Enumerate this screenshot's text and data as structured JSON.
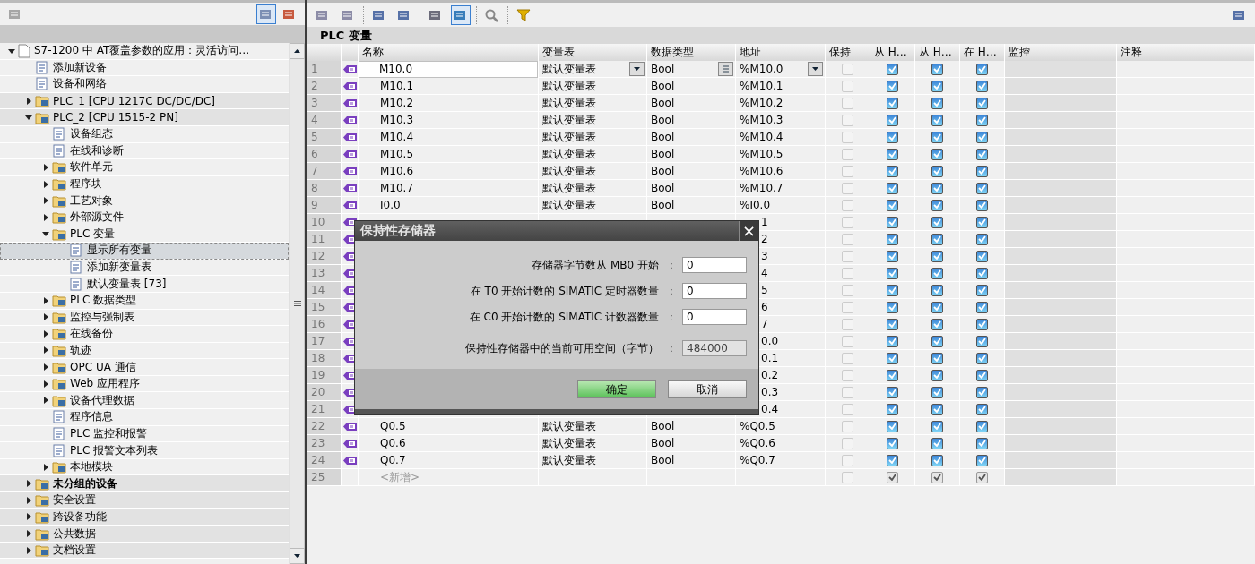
{
  "tree": {
    "items": [
      {
        "label": "S7-1200 中 AT覆盖参数的应用：灵活访问…",
        "kind": "project",
        "expanded": true,
        "selected": false,
        "children": [
          {
            "label": "添加新设备",
            "kind": "item",
            "selected": false
          },
          {
            "label": "设备和网络",
            "kind": "item",
            "selected": false
          },
          {
            "label": "PLC_1 [CPU 1217C DC/DC/DC]",
            "kind": "group",
            "expanded": false,
            "selected": false
          },
          {
            "label": "PLC_2 [CPU 1515-2 PN]",
            "kind": "group",
            "expanded": true,
            "selected": false,
            "children": [
              {
                "label": "设备组态",
                "kind": "item",
                "selected": false
              },
              {
                "label": "在线和诊断",
                "kind": "item",
                "selected": false
              },
              {
                "label": "软件单元",
                "kind": "item",
                "expanded": false,
                "selected": false
              },
              {
                "label": "程序块",
                "kind": "item",
                "expanded": false,
                "selected": false
              },
              {
                "label": "工艺对象",
                "kind": "item",
                "expanded": false,
                "selected": false
              },
              {
                "label": "外部源文件",
                "kind": "item",
                "expanded": false,
                "selected": false
              },
              {
                "label": "PLC 变量",
                "kind": "item",
                "expanded": true,
                "selected": false,
                "children": [
                  {
                    "label": "显示所有变量",
                    "kind": "item",
                    "selected": true
                  },
                  {
                    "label": "添加新变量表",
                    "kind": "item",
                    "selected": false
                  },
                  {
                    "label": "默认变量表 [73]",
                    "kind": "item",
                    "selected": false
                  }
                ]
              },
              {
                "label": "PLC 数据类型",
                "kind": "item",
                "expanded": false,
                "selected": false
              },
              {
                "label": "监控与强制表",
                "kind": "item",
                "expanded": false,
                "selected": false
              },
              {
                "label": "在线备份",
                "kind": "item",
                "expanded": false,
                "selected": false
              },
              {
                "label": "轨迹",
                "kind": "item",
                "expanded": false,
                "selected": false
              },
              {
                "label": "OPC UA 通信",
                "kind": "item",
                "expanded": false,
                "selected": false
              },
              {
                "label": "Web 应用程序",
                "kind": "item",
                "expanded": false,
                "selected": false
              },
              {
                "label": "设备代理数据",
                "kind": "item",
                "expanded": false,
                "selected": false
              },
              {
                "label": "程序信息",
                "kind": "item",
                "selected": false
              },
              {
                "label": "PLC 监控和报警",
                "kind": "item",
                "selected": false
              },
              {
                "label": "PLC 报警文本列表",
                "kind": "item",
                "selected": false
              },
              {
                "label": "本地模块",
                "kind": "item",
                "expanded": false,
                "selected": false
              }
            ]
          },
          {
            "label": "未分组的设备",
            "kind": "group",
            "bold": true,
            "expanded": false,
            "selected": false
          },
          {
            "label": "安全设置",
            "kind": "group",
            "expanded": false,
            "selected": false
          },
          {
            "label": "跨设备功能",
            "kind": "group",
            "expanded": false,
            "selected": false
          },
          {
            "label": "公共数据",
            "kind": "group",
            "expanded": false,
            "selected": false
          },
          {
            "label": "文档设置",
            "kind": "group",
            "expanded": false,
            "selected": false
          }
        ]
      }
    ]
  },
  "editor": {
    "title": "PLC 变量",
    "columns": [
      "名称",
      "变量表",
      "数据类型",
      "地址",
      "保持",
      "从 H…",
      "从 H…",
      "在 H…",
      "监控",
      "注释"
    ],
    "rows": [
      {
        "number": "1",
        "kind": "variable",
        "editing": true,
        "name": "M10.0",
        "table": "默认变量表",
        "type": "Bool",
        "address": "%M10.0",
        "checks": [
          false,
          true,
          true,
          true
        ]
      },
      {
        "number": "2",
        "kind": "variable",
        "editing": false,
        "name": "M10.1",
        "table": "默认变量表",
        "type": "Bool",
        "address": "%M10.1",
        "checks": [
          false,
          true,
          true,
          true
        ]
      },
      {
        "number": "3",
        "kind": "variable",
        "editing": false,
        "name": "M10.2",
        "table": "默认变量表",
        "type": "Bool",
        "address": "%M10.2",
        "checks": [
          false,
          true,
          true,
          true
        ]
      },
      {
        "number": "4",
        "kind": "variable",
        "editing": false,
        "name": "M10.3",
        "table": "默认变量表",
        "type": "Bool",
        "address": "%M10.3",
        "checks": [
          false,
          true,
          true,
          true
        ]
      },
      {
        "number": "5",
        "kind": "variable",
        "editing": false,
        "name": "M10.4",
        "table": "默认变量表",
        "type": "Bool",
        "address": "%M10.4",
        "checks": [
          false,
          true,
          true,
          true
        ]
      },
      {
        "number": "6",
        "kind": "variable",
        "editing": false,
        "name": "M10.5",
        "table": "默认变量表",
        "type": "Bool",
        "address": "%M10.5",
        "checks": [
          false,
          true,
          true,
          true
        ]
      },
      {
        "number": "7",
        "kind": "variable",
        "editing": false,
        "name": "M10.6",
        "table": "默认变量表",
        "type": "Bool",
        "address": "%M10.6",
        "checks": [
          false,
          true,
          true,
          true
        ]
      },
      {
        "number": "8",
        "kind": "variable",
        "editing": false,
        "name": "M10.7",
        "table": "默认变量表",
        "type": "Bool",
        "address": "%M10.7",
        "checks": [
          false,
          true,
          true,
          true
        ]
      },
      {
        "number": "9",
        "kind": "variable",
        "editing": false,
        "name": "I0.0",
        "table": "默认变量表",
        "type": "Bool",
        "address": "%I0.0",
        "checks": [
          false,
          true,
          true,
          true
        ]
      },
      {
        "number": "10",
        "kind": "covered",
        "address": "1",
        "checks": [
          false,
          true,
          true,
          true
        ]
      },
      {
        "number": "11",
        "kind": "covered",
        "address": "2",
        "checks": [
          false,
          true,
          true,
          true
        ]
      },
      {
        "number": "12",
        "kind": "covered",
        "address": "3",
        "checks": [
          false,
          true,
          true,
          true
        ]
      },
      {
        "number": "13",
        "kind": "covered",
        "address": "4",
        "checks": [
          false,
          true,
          true,
          true
        ]
      },
      {
        "number": "14",
        "kind": "covered",
        "address": "5",
        "checks": [
          false,
          true,
          true,
          true
        ]
      },
      {
        "number": "15",
        "kind": "covered",
        "address": "6",
        "checks": [
          false,
          true,
          true,
          true
        ]
      },
      {
        "number": "16",
        "kind": "covered",
        "address": "7",
        "checks": [
          false,
          true,
          true,
          true
        ]
      },
      {
        "number": "17",
        "kind": "covered",
        "address": "0.0",
        "checks": [
          false,
          true,
          true,
          true
        ]
      },
      {
        "number": "18",
        "kind": "covered",
        "address": "0.1",
        "checks": [
          false,
          true,
          true,
          true
        ]
      },
      {
        "number": "19",
        "kind": "covered",
        "address": "0.2",
        "checks": [
          false,
          true,
          true,
          true
        ]
      },
      {
        "number": "20",
        "kind": "covered",
        "address": "0.3",
        "checks": [
          false,
          true,
          true,
          true
        ]
      },
      {
        "number": "21",
        "kind": "covered",
        "address": "0.4",
        "checks": [
          false,
          true,
          true,
          true
        ]
      },
      {
        "number": "22",
        "kind": "variable",
        "editing": false,
        "name": "Q0.5",
        "table": "默认变量表",
        "type": "Bool",
        "address": "%Q0.5",
        "checks": [
          false,
          true,
          true,
          true
        ]
      },
      {
        "number": "23",
        "kind": "variable",
        "editing": false,
        "name": "Q0.6",
        "table": "默认变量表",
        "type": "Bool",
        "address": "%Q0.6",
        "checks": [
          false,
          true,
          true,
          true
        ]
      },
      {
        "number": "24",
        "kind": "variable",
        "editing": false,
        "name": "Q0.7",
        "table": "默认变量表",
        "type": "Bool",
        "address": "%Q0.7",
        "checks": [
          false,
          true,
          true,
          true
        ]
      },
      {
        "number": "25",
        "kind": "new",
        "name": "<新增>",
        "checks": [
          false,
          true,
          true,
          true
        ],
        "disabled": true
      }
    ]
  },
  "dialog": {
    "title": "保持性存储器",
    "close": "×",
    "fields": [
      {
        "label": "存储器字节数从 MB0 开始",
        "colon": "：",
        "value": "0",
        "disabled": false
      },
      {
        "label": "在 T0 开始计数的 SIMATIC 定时器数量",
        "colon": "：",
        "value": "0",
        "disabled": false
      },
      {
        "label": "在 C0 开始计数的 SIMATIC 计数器数量",
        "colon": "：",
        "value": "0",
        "disabled": false
      },
      {
        "label": "保持性存储器中的当前可用空间（字节）",
        "colon": "：",
        "value": "484000",
        "disabled": true
      }
    ],
    "buttons": [
      {
        "label": "确定",
        "primary": true
      },
      {
        "label": "取消",
        "primary": false
      }
    ]
  }
}
